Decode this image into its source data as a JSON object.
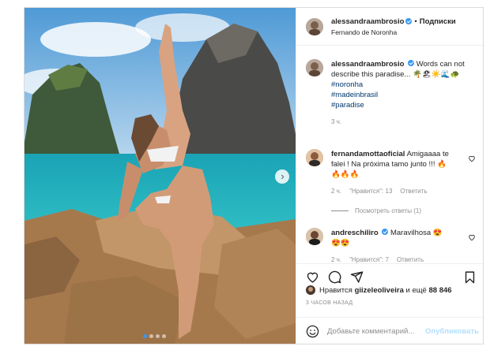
{
  "post": {
    "username": "alessandraambrosio",
    "follow_label": "Подписки",
    "separator": "•",
    "location": "Fernando de Noronha"
  },
  "caption": {
    "username": "alessandraambrosio",
    "text": "Words can not describe this paradise...",
    "emoji": "🌴🏖☀️🌊🐢",
    "tags": [
      "#noronha",
      "#madeinbrasil",
      "#paradise"
    ],
    "time": "3 ч."
  },
  "comments": [
    {
      "username": "fernandamottaoficial",
      "text": "Amigaaaa te falei ! Na próxima tamo junto !!! 🔥🔥🔥🔥",
      "time": "2 ч.",
      "likes": "\"Нравится\": 13",
      "reply": "Ответить",
      "view_replies": "Посмотреть ответы (1)"
    },
    {
      "username": "andreschiliro",
      "text": "Maravilhosa 😍 😍😍",
      "time": "2 ч.",
      "likes": "\"Нравится\": 7",
      "reply": "Ответить"
    }
  ],
  "likes": {
    "prefix": "Нравится",
    "user": "giizeleoliveira",
    "middle": "и ещё",
    "count": "88 846"
  },
  "timestamp": "3 ЧАСОВ НАЗАД",
  "add_comment": {
    "placeholder": "Добавьте комментарий...",
    "publish": "Опубликовать"
  },
  "carousel": {
    "total": 4,
    "active": 1
  },
  "colors": {
    "accent": "#3897f0",
    "link": "#00376b",
    "muted": "#8e8e8e"
  }
}
